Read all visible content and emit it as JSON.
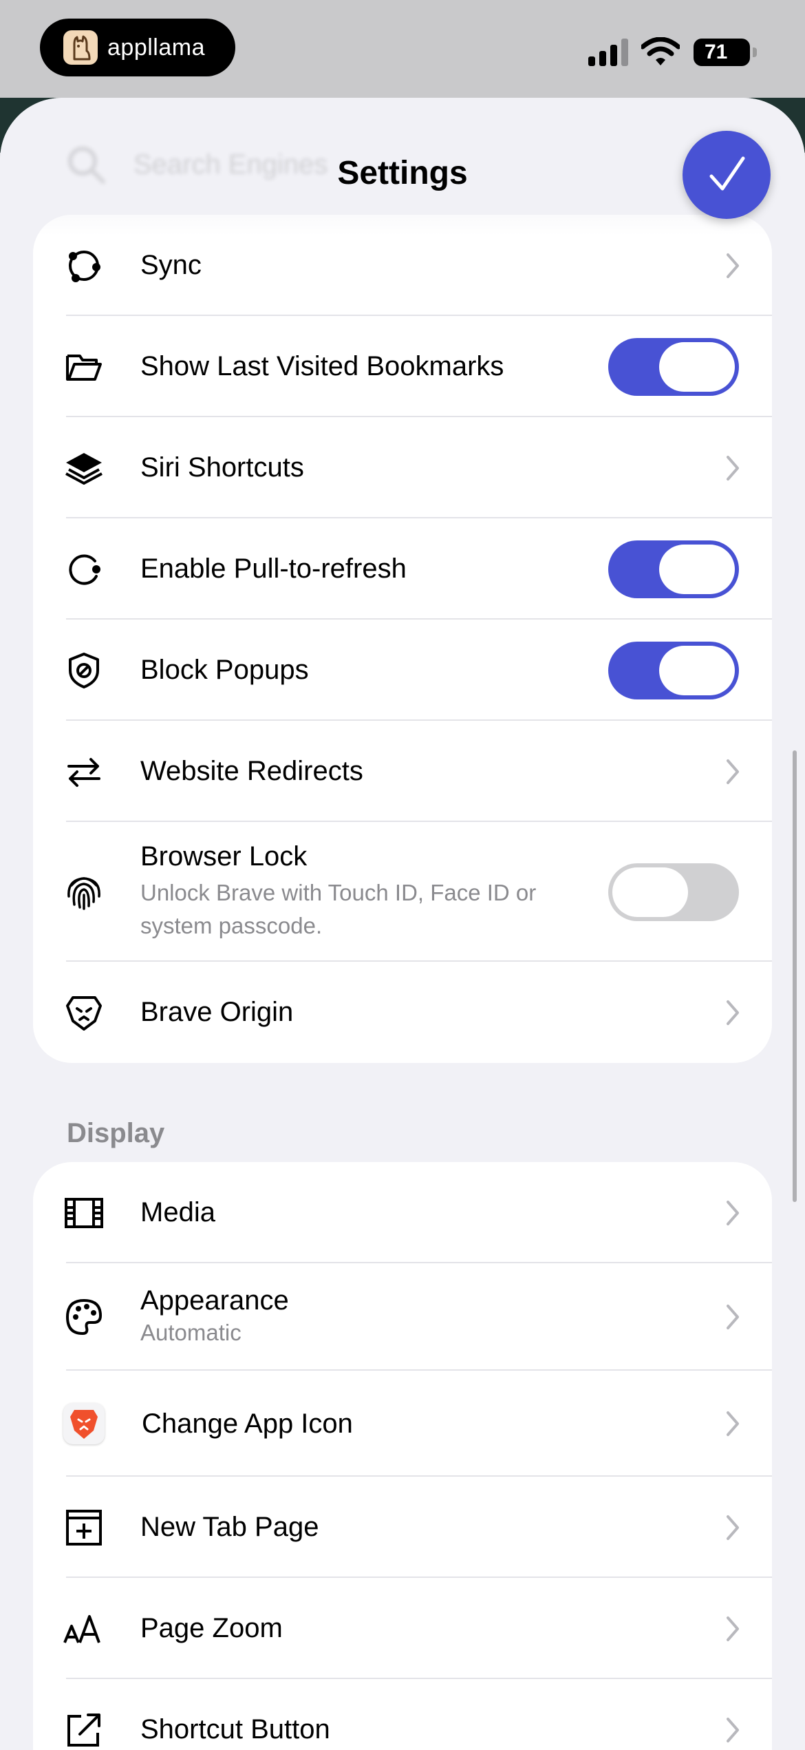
{
  "status_bar": {
    "app_badge": "appllama",
    "battery": "71"
  },
  "search": {
    "placeholder": "Search Engines"
  },
  "header": {
    "title": "Settings"
  },
  "general_group": {
    "rows": [
      {
        "label": "Sync",
        "icon": "sync-icon",
        "control": "chevron"
      },
      {
        "label": "Show Last Visited Bookmarks",
        "icon": "folder-icon",
        "control": "toggle",
        "value": true
      },
      {
        "label": "Siri Shortcuts",
        "icon": "layers-icon",
        "control": "chevron"
      },
      {
        "label": "Enable Pull-to-refresh",
        "icon": "refresh-icon",
        "control": "toggle",
        "value": true
      },
      {
        "label": "Block Popups",
        "icon": "shield-block-icon",
        "control": "toggle",
        "value": true
      },
      {
        "label": "Website Redirects",
        "icon": "redirect-arrows-icon",
        "control": "chevron"
      },
      {
        "label": "Browser Lock",
        "sublabel": "Unlock Brave with Touch ID, Face ID or system passcode.",
        "icon": "fingerprint-icon",
        "control": "toggle",
        "value": false
      },
      {
        "label": "Brave Origin",
        "icon": "lion-icon",
        "control": "chevron"
      }
    ]
  },
  "display_section": {
    "header": "Display",
    "rows": [
      {
        "label": "Media",
        "icon": "film-icon"
      },
      {
        "label": "Appearance",
        "sublabel": "Automatic",
        "icon": "palette-icon"
      },
      {
        "label": "Change App Icon",
        "icon": "brave-app-icon"
      },
      {
        "label": "New Tab Page",
        "icon": "new-tab-icon"
      },
      {
        "label": "Page Zoom",
        "icon": "text-size-icon"
      },
      {
        "label": "Shortcut Button",
        "icon": "external-link-icon"
      }
    ]
  },
  "colors": {
    "accent": "#4852d4",
    "background": "#f1f1f6",
    "toggle_off": "#d0d0d2"
  }
}
